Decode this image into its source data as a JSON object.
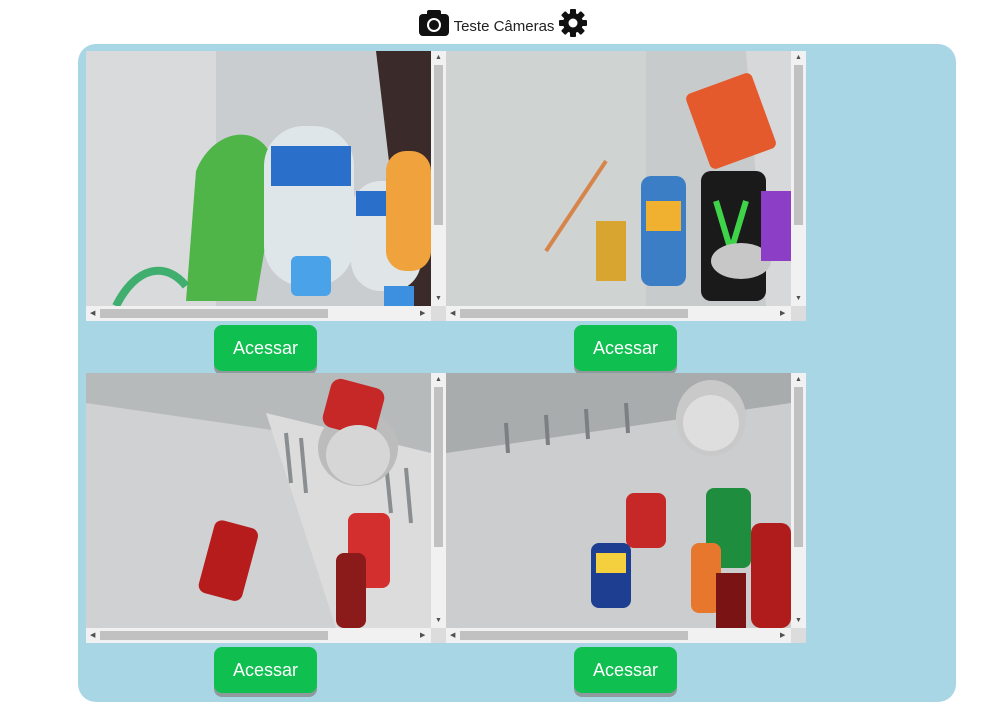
{
  "header": {
    "title": "Teste Câmeras"
  },
  "cameras": [
    {
      "scene": "bottles",
      "button_label": "Acessar"
    },
    {
      "scene": "cans-monster",
      "button_label": "Acessar"
    },
    {
      "scene": "cans-coke",
      "button_label": "Acessar"
    },
    {
      "scene": "cans-mixed",
      "button_label": "Acessar"
    }
  ],
  "colors": {
    "panel": "#a9d6e5",
    "button": "#0fbf4f",
    "button_text": "#ffffff"
  },
  "icons": [
    "camera-icon",
    "gear-icon"
  ]
}
